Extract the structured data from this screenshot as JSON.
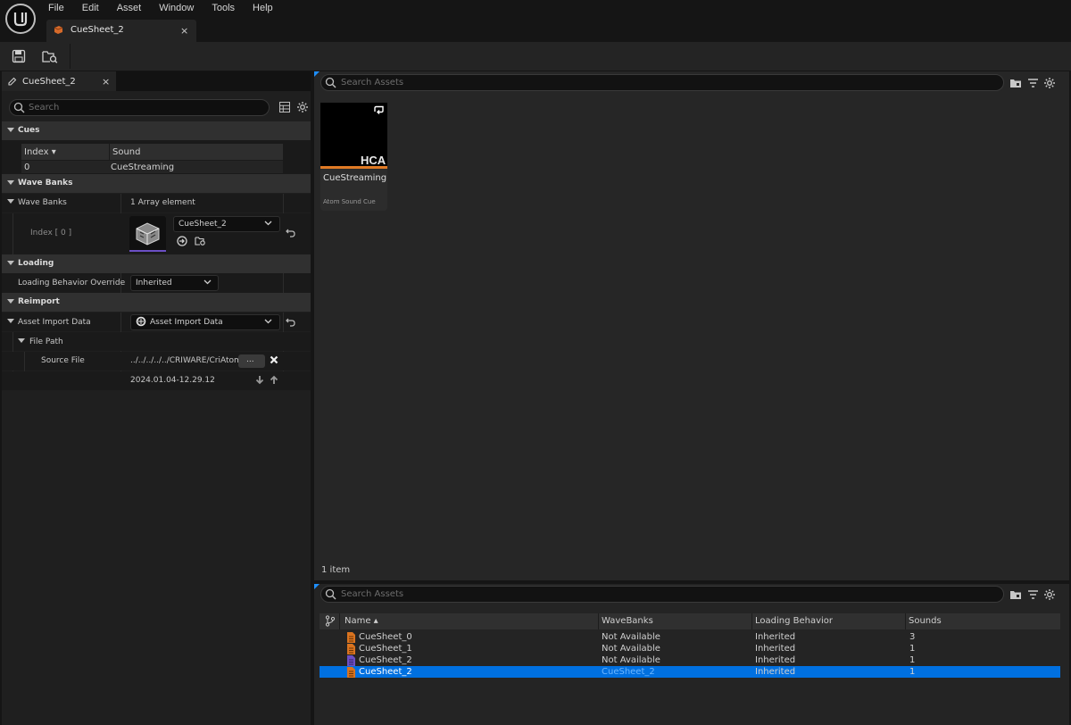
{
  "menu": [
    "File",
    "Edit",
    "Asset",
    "Window",
    "Tools",
    "Help"
  ],
  "document_tab": {
    "label": "CueSheet_2",
    "close": "×"
  },
  "details": {
    "tab_label": "CueSheet_2",
    "tab_close": "×",
    "search_placeholder": "Search",
    "cues": {
      "title": "Cues",
      "columns": [
        "Index ▾",
        "Sound"
      ],
      "rows": [
        {
          "index": "0",
          "sound": "CueStreaming"
        }
      ]
    },
    "wave_banks": {
      "title": "Wave Banks",
      "label": "Wave Banks",
      "value": "1 Array element",
      "index_label": "Index [ 0 ]",
      "asset": "CueSheet_2"
    },
    "loading": {
      "title": "Loading",
      "label": "Loading Behavior Override",
      "value": "Inherited"
    },
    "reimport": {
      "title": "Reimport",
      "asset_import_label": "Asset Import Data",
      "asset_import_value": "Asset Import Data",
      "file_path_label": "File Path",
      "source_file_label": "Source File",
      "source_file_value": "../../../../../CRIWARE/CriAtom",
      "browse": "...",
      "timestamp": "2024.01.04-12.29.12"
    }
  },
  "content_browser": {
    "search_placeholder": "Search Assets",
    "tile": {
      "badge": "HCA",
      "name": "CueStreaming",
      "type": "Atom Sound Cue"
    },
    "item_count": "1 item"
  },
  "list_view": {
    "search_placeholder": "Search Assets",
    "columns": [
      "Name ▴",
      "WaveBanks",
      "Loading Behavior",
      "Sounds"
    ],
    "rows": [
      {
        "name": "CueSheet_0",
        "wavebanks": "Not Available",
        "loading": "Inherited",
        "sounds": "3",
        "icon_color": "#d9731f"
      },
      {
        "name": "CueSheet_1",
        "wavebanks": "Not Available",
        "loading": "Inherited",
        "sounds": "1",
        "icon_color": "#d9731f"
      },
      {
        "name": "CueSheet_2",
        "wavebanks": "Not Available",
        "loading": "Inherited",
        "sounds": "1",
        "icon_color": "#6b4fc4"
      },
      {
        "name": "CueSheet_2",
        "wavebanks": "CueSheet_2",
        "loading": "Inherited",
        "sounds": "1",
        "icon_color": "#d9731f",
        "selected": true
      }
    ]
  },
  "colors": {
    "accent": "#0070e0",
    "hca_bar": "#e07a24",
    "wave_bank_underline": "#6b4fc4"
  }
}
